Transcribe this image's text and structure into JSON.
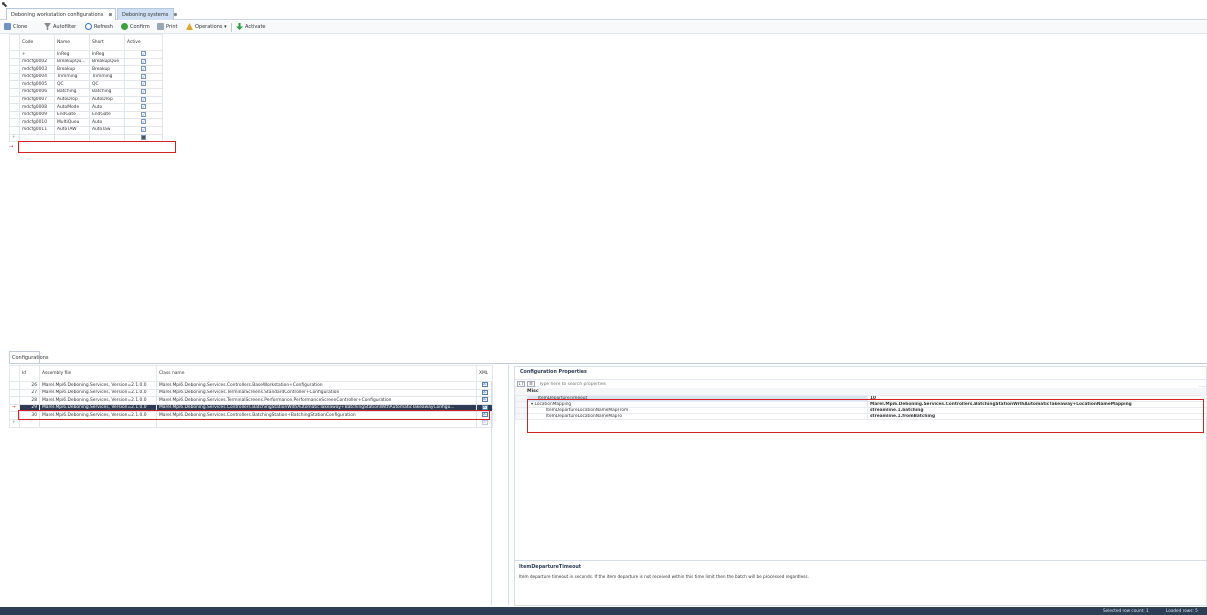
{
  "tabs": [
    {
      "label": "Deboning workstation configurations",
      "close": "⊗"
    },
    {
      "label": "Deboning systems",
      "close": "⊗"
    }
  ],
  "toolbar": {
    "clone": "Clone",
    "autofilter": "Autofilter",
    "refresh": "Refresh",
    "confirm": "Confirm",
    "print": "Print",
    "operations": "Operations",
    "activate": "Activate"
  },
  "top_grid": {
    "headers": [
      "Code",
      "Name",
      "Short",
      "Active"
    ],
    "new_row_marker": "+",
    "rows": [
      {
        "code": "+",
        "name": "InReg",
        "short": "InReg",
        "active": true
      },
      {
        "code": "mdcfg0002",
        "name": "BreakupQu...",
        "short": "BreakupQue",
        "active": true
      },
      {
        "code": "mdcfg0003",
        "name": "Breakup",
        "short": "Breakup",
        "active": true
      },
      {
        "code": "mdcfg0004",
        "name": "Trimming",
        "short": "Trimming",
        "active": true
      },
      {
        "code": "mdcfg0005",
        "name": "QC",
        "short": "QC",
        "active": true
      },
      {
        "code": "mdcfg0006",
        "name": "Batching",
        "short": "Batching",
        "active": true
      },
      {
        "code": "mdcfg0007",
        "name": "AutoDrop",
        "short": "AutoDrop",
        "active": true
      },
      {
        "code": "mdcfg0008",
        "name": "AutoMode",
        "short": "Auto",
        "active": true
      },
      {
        "code": "mdcfg0009",
        "name": "EndGate",
        "short": "EndGate",
        "active": true
      },
      {
        "code": "mdcfg0010",
        "name": "MultiQueu",
        "short": "Auto",
        "active": true
      },
      {
        "code": "mdcfg0011",
        "name": "AutoTAW",
        "short": "AutoTaw",
        "active": true
      }
    ]
  },
  "configurations_tab": "Configurations",
  "bottom_grid": {
    "headers": [
      "Id",
      "Assembly file",
      "Class name",
      "XML"
    ],
    "rows": [
      {
        "id": "26",
        "assembly": "Marel.Mpi6.Deboning.Services, Version=2.1.0.0",
        "class": "Marel.Mpi6.Deboning.Services.Controllers.BaseWorkstation+Configuration"
      },
      {
        "id": "27",
        "assembly": "Marel.Mpi6.Deboning.Services, Version=2.1.0.0",
        "class": "Marel.Mpi6.Deboning.Services.TerminalScreens.StandardController+Configuration"
      },
      {
        "id": "28",
        "assembly": "Marel.Mpi6.Deboning.Services, Version=2.1.0.0",
        "class": "Marel.Mpi6.Deboning.Services.TerminalScreens.Performance.PerformanceScreenController+Configuration"
      },
      {
        "id": "29",
        "assembly": "Marel.Mpi6.Deboning.Services, Version=2.1.0.0",
        "class": "Marel.Mpi6.Deboning.Services.Controllers.BatchingStationWithAutomaticTakeaway+BatchingStationWithAutomaticTakeawayConfigu..."
      },
      {
        "id": "30",
        "assembly": "Marel.Mpi6.Deboning.Services, Version=2.1.0.0",
        "class": "Marel.Mpi6.Deboning.Services.Controllers.BatchingStation+BatchingStationConfiguration"
      }
    ]
  },
  "properties": {
    "title": "Configuration Properties",
    "search_placeholder": "Type here to search properties",
    "category": "Misc",
    "rows": [
      {
        "name": "ItemDepartureTimeout",
        "value": "10"
      },
      {
        "name": "LocationMapping",
        "value": "Marel.Mpi6.Deboning.Services.Controllers.BatchingStationWithAutomaticTakeaway+LocationNameMapping"
      },
      {
        "name": "ItemDepartureLocationNameMapFrom",
        "value": "streamline.1.batching"
      },
      {
        "name": "ItemDepartureLocationNameMapTo",
        "value": "streamline.1.fromBatching"
      }
    ],
    "desc_title": "ItemDepartureTimeout",
    "desc_text": "Item departure timeout in seconds. If the item departure is not received within this time limit then the batch will be processed regardless."
  },
  "status": {
    "selected": "Selected row count: 1",
    "loaded": "Loaded rows: 5"
  },
  "colors": {
    "highlight": "#d92020",
    "selected_row": "#2d3c52",
    "statusbar": "#2e3f55"
  }
}
